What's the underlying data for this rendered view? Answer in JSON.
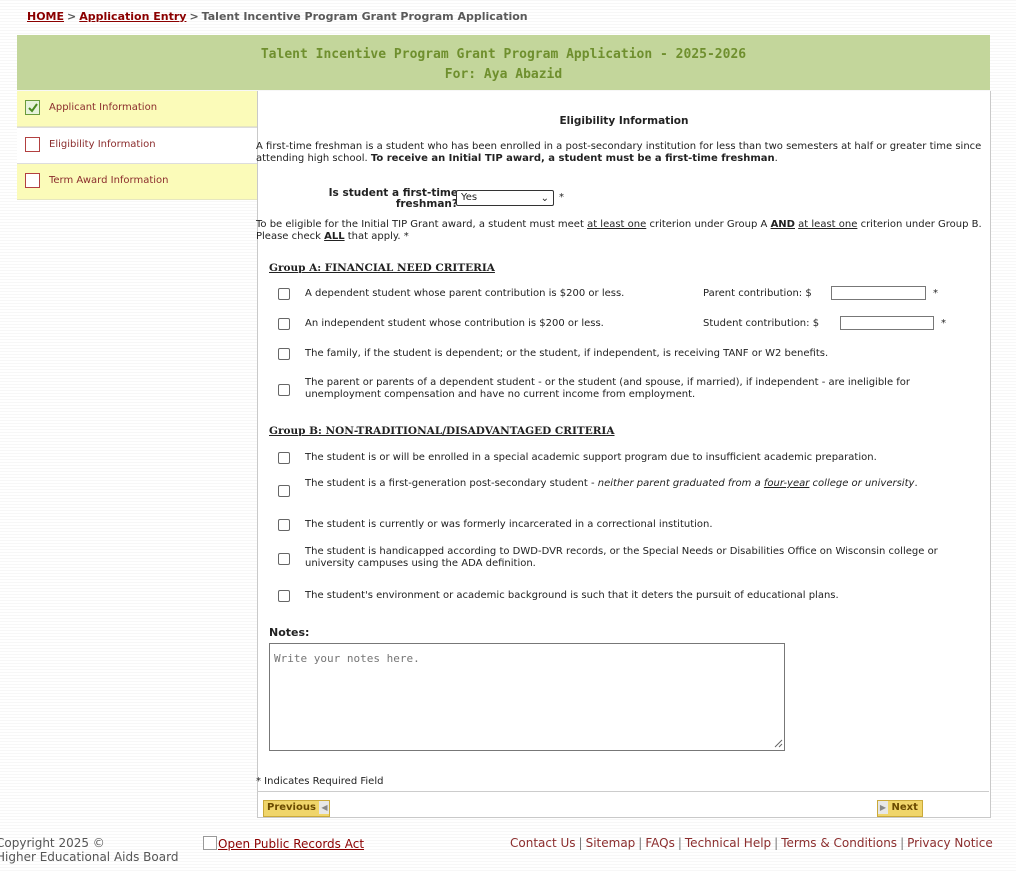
{
  "breadcrumb": {
    "home": "HOME",
    "entry": "Application Entry",
    "current": "Talent Incentive Program Grant Program Application",
    "separator": ">"
  },
  "header": {
    "title": "Talent Incentive Program Grant Program Application - 2025-2026",
    "subtitle": "For: Aya Abazid",
    "color": "#c3d69b"
  },
  "sidebar": {
    "items": [
      {
        "label": "Applicant Information",
        "status": "complete"
      },
      {
        "label": "Eligibility Information",
        "status": "current"
      },
      {
        "label": "Term Award Information",
        "status": "incomplete"
      }
    ]
  },
  "section_title": "Eligibility Information",
  "intro": {
    "plain": "A first-time freshman is a student who has been enrolled in a post-secondary institution for less than two semesters at half or greater time since attending high school.",
    "bold": "To receive an Initial TIP award, a student must be a first-time freshman",
    "end": "."
  },
  "freshman": {
    "question": "Is student a first-time freshman?",
    "value": "Yes",
    "required": "*"
  },
  "eligibility_note": {
    "p1": "To be eligible for the Initial TIP Grant award, a student must meet ",
    "u1": "at least one",
    "p2": " criterion under Group A ",
    "and": "AND",
    "sp": " ",
    "u2": "at least one",
    "p3": " criterion under Group B. Please check ",
    "all": "ALL",
    "p4": " that apply. *"
  },
  "group_a": {
    "title": "Group A: FINANCIAL NEED CRITERIA",
    "items": [
      "A dependent student whose parent contribution is $200 or less.",
      "An independent student whose contribution is $200 or less.",
      "The family, if the student is dependent; or the student, if independent, is receiving TANF or W2 benefits.",
      "The parent or parents of a dependent student - or the student (and spouse, if married), if independent - are ineligible for unemployment compensation and have no current income from employment."
    ],
    "parent_contribution_label": "Parent contribution: $",
    "student_contribution_label": "Student contribution: $",
    "required": "*"
  },
  "group_b": {
    "title": "Group B: NON-TRADITIONAL/DISADVANTAGED CRITERIA",
    "items": [
      "The student is or will be enrolled in a special academic support program due to insufficient academic preparation.",
      "The student is currently or was formerly incarcerated in a correctional institution.",
      "The student is handicapped according to DWD-DVR records, or the Special Needs or Disabilities Office on Wisconsin college or university campuses using the ADA definition.",
      "The student's environment or academic background is such that it deters the pursuit of educational plans."
    ],
    "first_gen": {
      "plain": "The student is a first-generation post-secondary student - ",
      "ital1": "neither parent graduated from a ",
      "ital_u": "four-year",
      "ital2": " college or university",
      "end": "."
    }
  },
  "notes": {
    "label": "Notes:",
    "placeholder": "Write your notes here."
  },
  "required_note": "* Indicates Required Field",
  "nav": {
    "previous": "Previous",
    "next": "Next"
  },
  "footer": {
    "copyright": "Copyright 2025 ©",
    "org": "Higher Educational Aids Board",
    "open_records": "Open Public Records Act",
    "links": [
      "Contact Us",
      "Sitemap",
      "FAQs",
      "Technical Help",
      "Terms & Conditions",
      "Privacy Notice"
    ]
  }
}
